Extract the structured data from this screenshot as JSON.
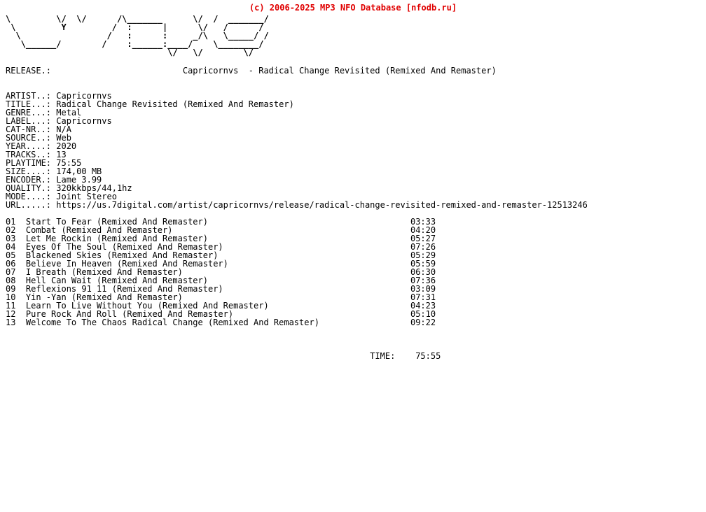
{
  "header": {
    "copyright": "(c) 2006-2025 MP3 NFO Database [nfodb.ru]",
    "copyright_color": "#e00000"
  },
  "logo": {
    "alt": "ascii-art-group-logo",
    "lines": [
      "\\         \\/  \\/      /\\_______      \\/  /  _______/",
      " \\         Y         /  :      |      \\/   /      /",
      "  \\                 /   :      :     _/\\   \\_____/ /",
      "   \\______/        /    :______:____/    \\________/",
      "                                \\/   \\/        \\/"
    ]
  },
  "release": {
    "label": "RELEASE.:",
    "value": "Capricornvs  - Radical Change Revisited (Remixed And Remaster)"
  },
  "info": {
    "fields": [
      {
        "label": "ARTIST..:",
        "value": "Capricornvs"
      },
      {
        "label": "TITLE...:",
        "value": "Radical Change Revisited (Remixed And Remaster)"
      },
      {
        "label": "GENRE...:",
        "value": "Metal"
      },
      {
        "label": "LABEL...:",
        "value": "Capricornvs"
      },
      {
        "label": "CAT-NR..:",
        "value": "N/A"
      },
      {
        "label": "SOURCE..:",
        "value": "Web"
      },
      {
        "label": "YEAR....:",
        "value": "2020"
      },
      {
        "label": "TRACKS..:",
        "value": "13"
      },
      {
        "label": "PLAYTIME:",
        "value": "75:55"
      },
      {
        "label": "SIZE....:",
        "value": "174,00 MB"
      },
      {
        "label": "ENCODER.:",
        "value": "Lame 3.99"
      },
      {
        "label": "QUALITY.:",
        "value": "320kkbps/44,1hz"
      },
      {
        "label": "MODE....:",
        "value": "Joint Stereo"
      },
      {
        "label": "URL.....:",
        "value": "https://us.7digital.com/artist/capricornvs/release/radical-change-revisited-remixed-and-remaster-12513246"
      }
    ]
  },
  "tracklist": {
    "tracks": [
      {
        "num": "01",
        "title": "Start To Fear (Remixed And Remaster)",
        "time": "03:33"
      },
      {
        "num": "02",
        "title": "Combat (Remixed And Remaster)",
        "time": "04:20"
      },
      {
        "num": "03",
        "title": "Let Me Rockin (Remixed And Remaster)",
        "time": "05:27"
      },
      {
        "num": "04",
        "title": "Eyes Of The Soul (Remixed And Remaster)",
        "time": "07:26"
      },
      {
        "num": "05",
        "title": "Blackened Skies (Remixed And Remaster)",
        "time": "05:29"
      },
      {
        "num": "06",
        "title": "Believe In Heaven (Remixed And Remaster)",
        "time": "05:59"
      },
      {
        "num": "07",
        "title": "I Breath (Remixed And Remaster)",
        "time": "06:30"
      },
      {
        "num": "08",
        "title": "Hell Can Wait (Remixed And Remaster)",
        "time": "07:36"
      },
      {
        "num": "09",
        "title": "Reflexions 91 11 (Remixed And Remaster)",
        "time": "03:09"
      },
      {
        "num": "10",
        "title": "Yin -Yan (Remixed And Remaster)",
        "time": "07:31"
      },
      {
        "num": "11",
        "title": "Learn To Live Without You (Remixed And Remaster)",
        "time": "04:23"
      },
      {
        "num": "12",
        "title": "Pure Rock And Roll (Remixed And Remaster)",
        "time": "05:10"
      },
      {
        "num": "13",
        "title": "Welcome To The Chaos Radical Change (Remixed And Remaster)",
        "time": "09:22"
      }
    ]
  },
  "footer": {
    "total_label": "TIME:",
    "total_time": "75:55"
  }
}
